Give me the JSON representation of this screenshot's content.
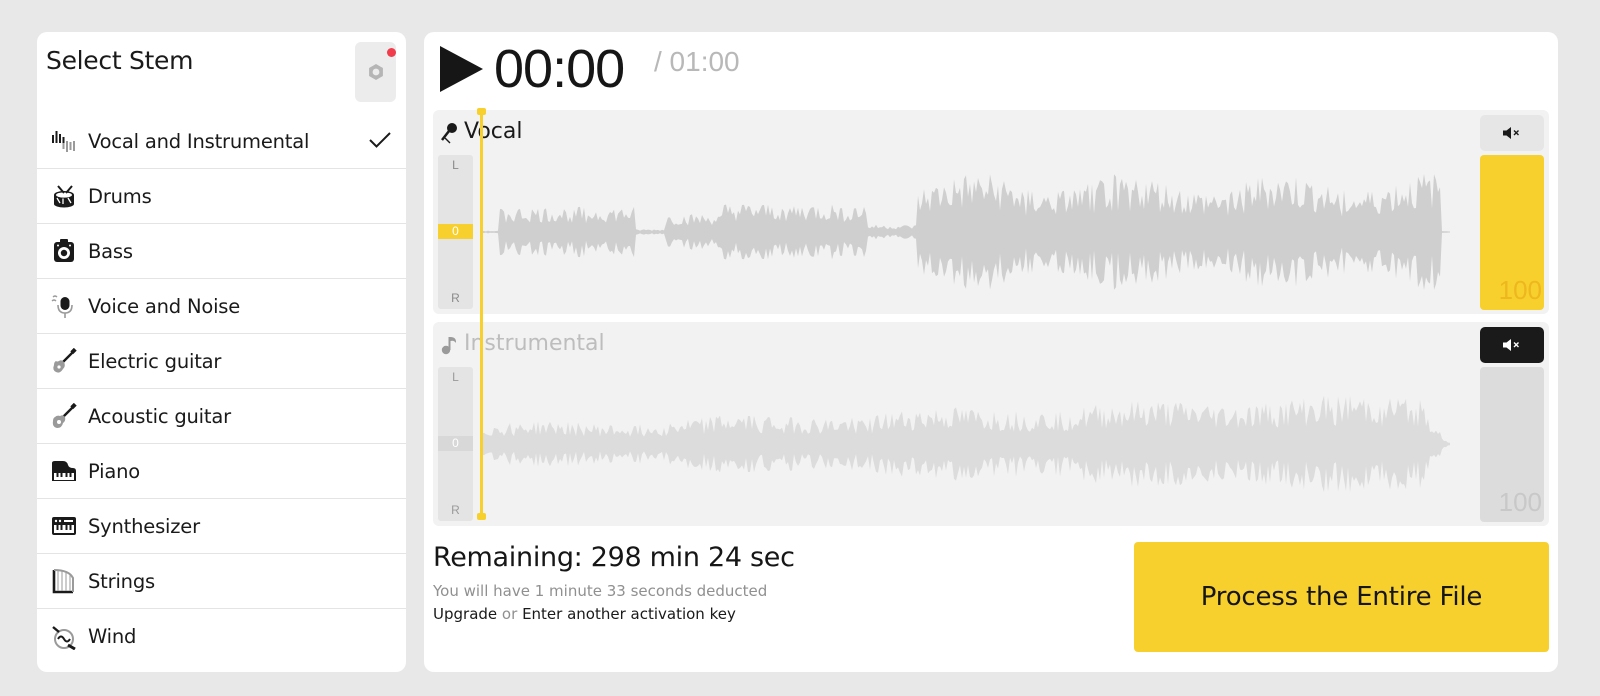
{
  "sidebar": {
    "title": "Select Stem",
    "items": [
      {
        "label": "Vocal and Instrumental",
        "icon": "waveform-icon",
        "selected": true
      },
      {
        "label": "Drums",
        "icon": "drum-icon",
        "selected": false
      },
      {
        "label": "Bass",
        "icon": "bass-amp-icon",
        "selected": false
      },
      {
        "label": "Voice and Noise",
        "icon": "microphone-icon",
        "selected": false
      },
      {
        "label": "Electric guitar",
        "icon": "electric-guitar-icon",
        "selected": false
      },
      {
        "label": "Acoustic guitar",
        "icon": "acoustic-guitar-icon",
        "selected": false
      },
      {
        "label": "Piano",
        "icon": "piano-icon",
        "selected": false
      },
      {
        "label": "Synthesizer",
        "icon": "synthesizer-icon",
        "selected": false
      },
      {
        "label": "Strings",
        "icon": "harp-icon",
        "selected": false
      },
      {
        "label": "Wind",
        "icon": "horn-icon",
        "selected": false
      }
    ]
  },
  "player": {
    "current_time": "00:00",
    "total_time": "/ 01:00"
  },
  "tracks": {
    "vocal": {
      "name": "Vocal",
      "pan_left": "L",
      "pan_zero": "0",
      "pan_right": "R",
      "volume": "100",
      "muted": false
    },
    "instrumental": {
      "name": "Instrumental",
      "pan_left": "L",
      "pan_zero": "0",
      "pan_right": "R",
      "volume": "100",
      "muted": true
    }
  },
  "footer": {
    "remaining": "Remaining: 298 min 24 sec",
    "deduct_note": "You will have 1 minute 33 seconds deducted",
    "upgrade_label": "Upgrade",
    "or_label": "or",
    "activation_label": "Enter another activation key",
    "process_label": "Process the Entire File"
  },
  "colors": {
    "accent": "#f7d02e",
    "notification": "#f03c4b",
    "waveform_vocal": "#cfcfcf",
    "waveform_inst": "#dcdcdc"
  }
}
